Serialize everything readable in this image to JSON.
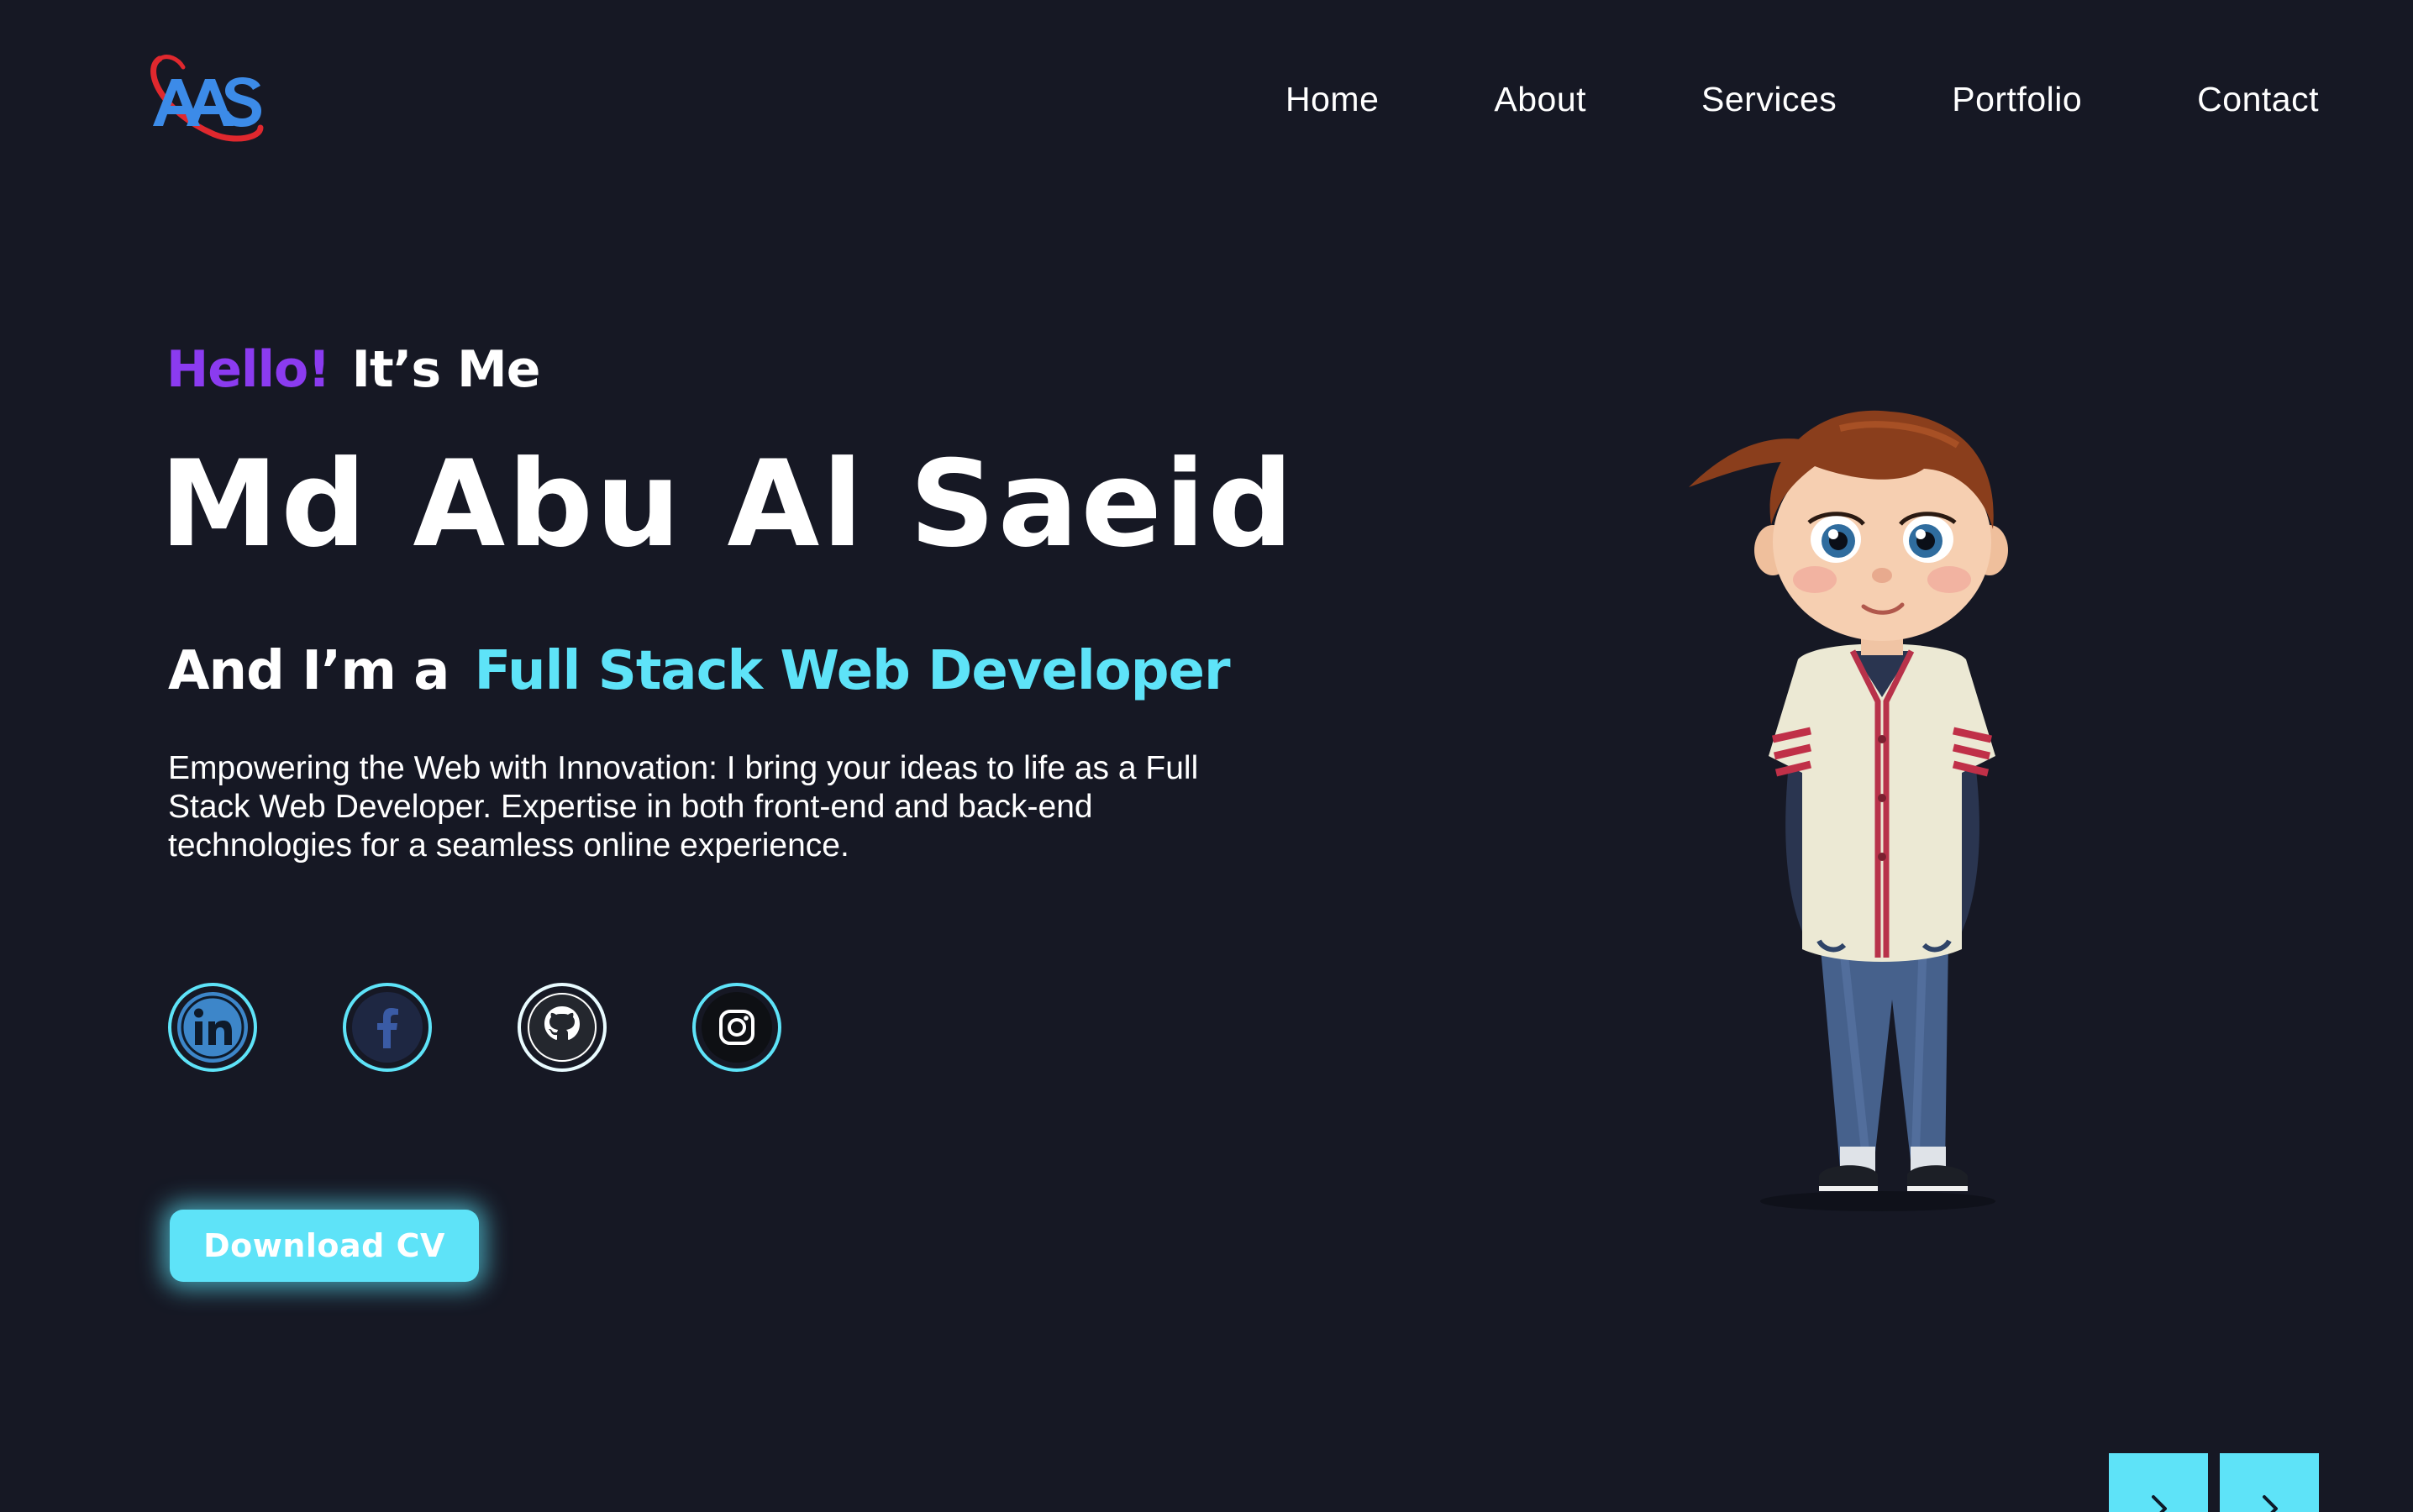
{
  "header": {
    "logo_text": "AAS",
    "nav": [
      {
        "label": "Home"
      },
      {
        "label": "About"
      },
      {
        "label": "Services"
      },
      {
        "label": "Portfolio"
      },
      {
        "label": "Contact"
      }
    ]
  },
  "hero": {
    "greeting_hello": "Hello!",
    "greeting_rest": "It’s Me",
    "name": "Md Abu Al Saeid",
    "role_prefix": "And I’m a",
    "role_title": "Full Stack Web Developer",
    "description": "Empowering the Web with Innovation: I bring your ideas to life as a Full Stack Web Developer. Expertise in both front-end and back-end technologies for a seamless online experience.",
    "download_label": "Download CV"
  },
  "social": [
    {
      "icon": "linkedin-icon"
    },
    {
      "icon": "facebook-icon"
    },
    {
      "icon": "github-icon"
    },
    {
      "icon": "instagram-icon"
    }
  ],
  "colors": {
    "background": "#161824",
    "accent_cyan": "#5ee3f8",
    "accent_purple": "#8b3bf0",
    "text": "#ffffff"
  },
  "illustration": {
    "icon": "cartoon-boy-avatar"
  },
  "carousel_controls": [
    {
      "icon": "chevron-right-icon"
    },
    {
      "icon": "chevron-right-icon"
    }
  ]
}
